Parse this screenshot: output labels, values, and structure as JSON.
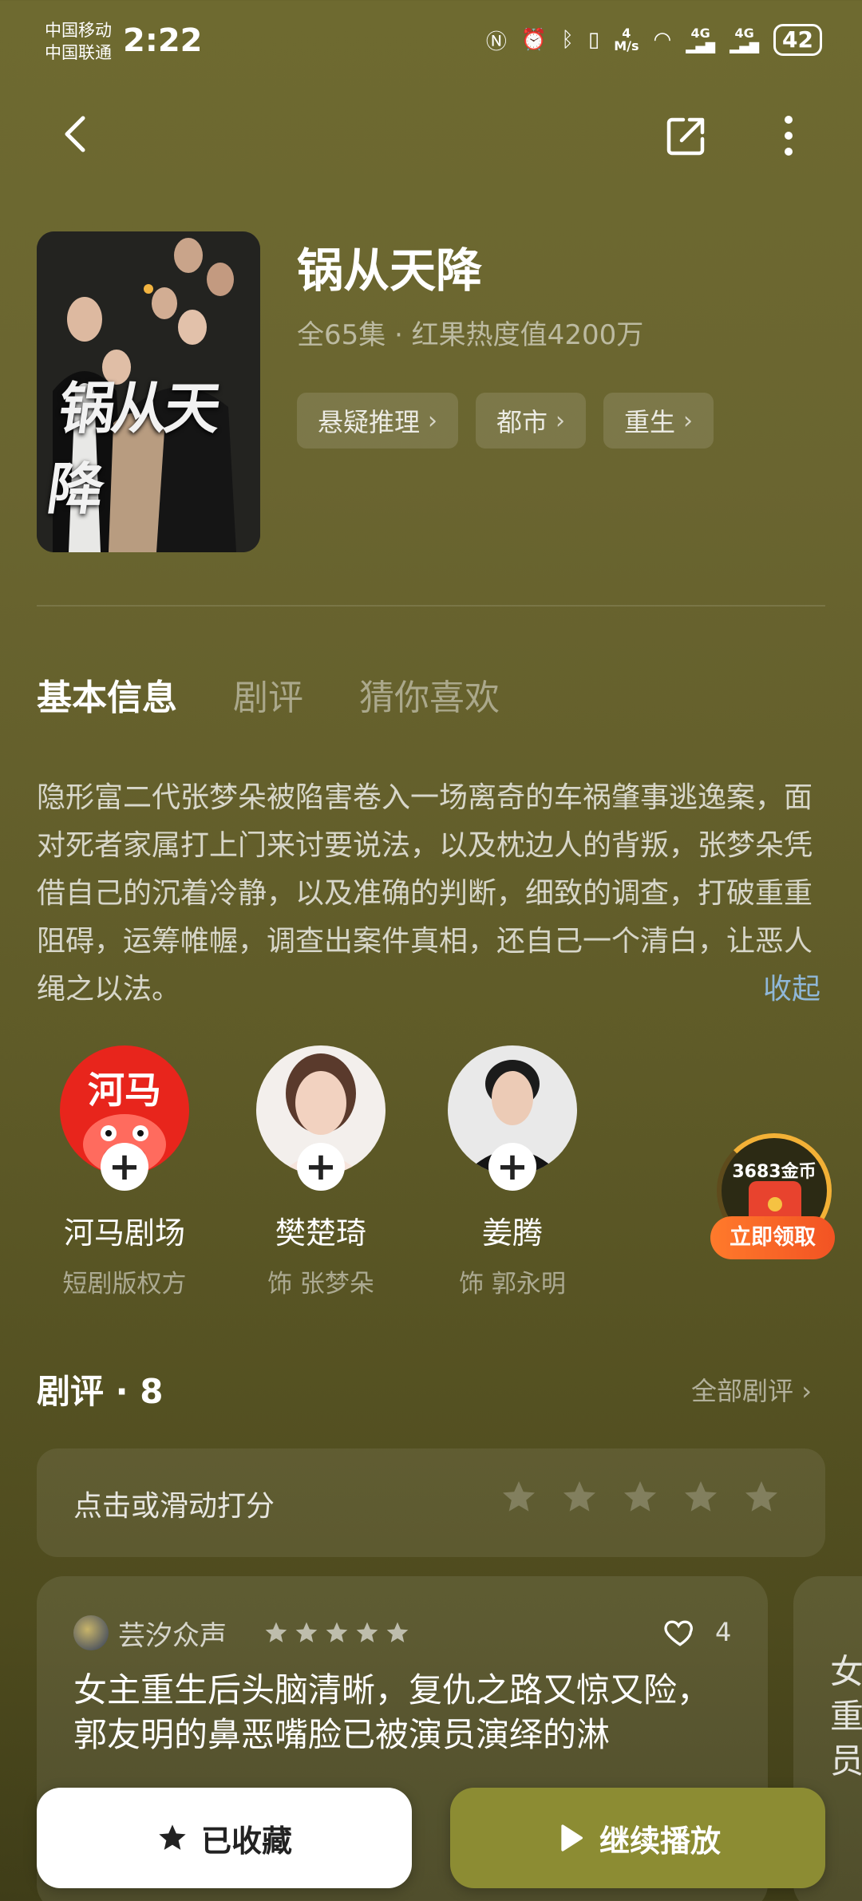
{
  "status_bar": {
    "carrier1": "中国移动",
    "carrier2": "中国联通",
    "time": "2:22",
    "net_speed_top": "4",
    "net_speed_unit": "M/s",
    "signal1": "4G",
    "signal2": "4G",
    "battery": "42"
  },
  "show": {
    "title": "锅从天降",
    "poster_title": "锅从天降",
    "meta": "全65集 · 红果热度值4200万",
    "tags": [
      "悬疑推理",
      "都市",
      "重生"
    ]
  },
  "tabs": [
    "基本信息",
    "剧评",
    "猜你喜欢"
  ],
  "synopsis": "隐形富二代张梦朵被陷害卷入一场离奇的车祸肇事逃逸案，面对死者家属打上门来讨要说法，以及枕边人的背叛，张梦朵凭借自己的沉着冷静，以及准确的判断，细致的调查，打破重重阻碍，运筹帷幄，调查出案件真相，还自己一个清白，让恶人绳之以法。",
  "collapse_label": "收起",
  "cast": [
    {
      "name": "河马剧场",
      "role": "短剧版权方",
      "logo_text": "河马"
    },
    {
      "name": "樊楚琦",
      "role": "饰 张梦朵"
    },
    {
      "name": "姜腾",
      "role": "饰 郭永明"
    }
  ],
  "coin_widget": {
    "count": "3683金币",
    "button": "立即领取"
  },
  "reviews": {
    "title": "剧评 · 8",
    "all_label": "全部剧评",
    "rate_prompt": "点击或滑动打分",
    "rate_value": 0,
    "rate_max": 5,
    "items": [
      {
        "user": "芸汐众声",
        "stars": 5,
        "likes": "4",
        "text": "女主重生后头脑清晰，复仇之路又惊又险，郭友明的鼻恶嘴脸已被演员演绎的淋"
      }
    ],
    "next_card_text": "女重员"
  },
  "bottom": {
    "favorite_label": "已收藏",
    "play_label": "继续播放"
  },
  "colors": {
    "background": "#6a6530",
    "play_button": "#8c8c33",
    "collapse_link": "#8fb7d8",
    "coin_button": "#f25323"
  }
}
